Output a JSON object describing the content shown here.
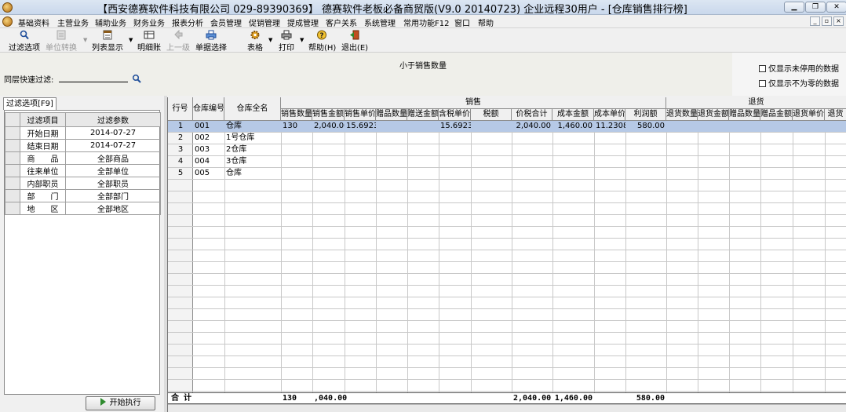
{
  "window": {
    "title": "【西安德赛软件科技有限公司 029-89390369】 德赛软件老板必备商贸版(V9.0 20140723) 企业远程30用户 - [仓库销售排行榜]",
    "min_label": "▁",
    "max_label": "❐",
    "close_label": "✕"
  },
  "menu": {
    "items": [
      "基础资料",
      "主营业务",
      "辅助业务",
      "财务业务",
      "报表分析",
      "会员管理",
      "促销管理",
      "提成管理",
      "客户关系",
      "系统管理",
      "常用功能F12",
      "窗口",
      "帮助"
    ],
    "mdi_min": "_",
    "mdi_restore": "▫",
    "mdi_close": "×"
  },
  "toolbar": {
    "filter_options": "过滤选项",
    "unit_convert": "单位转换",
    "list_display": "列表显示",
    "detail_account": "明细账",
    "prev_level": "上一级",
    "document_select": "单据选择",
    "table": "表格",
    "print": "打印",
    "help": "帮助(H)",
    "exit": "退出(E)"
  },
  "subheader": {
    "title": "小于销售数量",
    "quick_filter_label": "同层快速过滤:",
    "show_disabled_only": "仅显示未停用的数据",
    "show_nonzero_only": "仅显示不为零的数据"
  },
  "filter_panel": {
    "tab_label": "过滤选项[F9]",
    "col_item": "过滤项目",
    "col_param": "过滤参数",
    "rows": [
      {
        "item": "开始日期",
        "param": "2014-07-27"
      },
      {
        "item": "结束日期",
        "param": "2014-07-27"
      },
      {
        "item": "商　　品",
        "param": "全部商品"
      },
      {
        "item": "往来单位",
        "param": "全部单位"
      },
      {
        "item": "内部职员",
        "param": "全部职员"
      },
      {
        "item": "部　　门",
        "param": "全部部门"
      },
      {
        "item": "地　　区",
        "param": "全部地区"
      }
    ],
    "run_button": "开始执行"
  },
  "grid": {
    "col_rownum": "行号",
    "col_code": "仓库编号",
    "col_name": "仓库全名",
    "group_sales": "销售",
    "group_returns": "退货",
    "sales_cols": [
      "销售数量",
      "销售金额",
      "销售单价",
      "赠品数量",
      "赠送金额",
      "含税单价",
      "税额",
      "价税合计",
      "成本金额",
      "成本单价",
      "利润额"
    ],
    "return_cols": [
      "退货数量",
      "退货金额",
      "赠品数量",
      "赠品金额",
      "退货单价",
      "退货"
    ],
    "rows": [
      {
        "n": "1",
        "code": "001",
        "name": "仓库",
        "qty": "130",
        "amount": "2,040.00",
        "price": "15.6923",
        "tax_price": "15.6923",
        "total": "2,040.00",
        "cost": "1,460.00",
        "cost_price": "11.2308",
        "profit": "580.00"
      },
      {
        "n": "2",
        "code": "002",
        "name": "1号仓库",
        "qty": "",
        "amount": "",
        "price": "",
        "tax_price": "",
        "total": "",
        "cost": "",
        "cost_price": "",
        "profit": ""
      },
      {
        "n": "3",
        "code": "003",
        "name": "2仓库",
        "qty": "",
        "amount": "",
        "price": "",
        "tax_price": "",
        "total": "",
        "cost": "",
        "cost_price": "",
        "profit": ""
      },
      {
        "n": "4",
        "code": "004",
        "name": "3仓库",
        "qty": "",
        "amount": "",
        "price": "",
        "tax_price": "",
        "total": "",
        "cost": "",
        "cost_price": "",
        "profit": ""
      },
      {
        "n": "5",
        "code": "005",
        "name": "仓库",
        "qty": "",
        "amount": "",
        "price": "",
        "tax_price": "",
        "total": "",
        "cost": "",
        "cost_price": "",
        "profit": ""
      }
    ],
    "totals": {
      "label": "合 计",
      "qty": "130",
      "amount": ",040.00",
      "total": "2,040.00",
      "cost": "1,460.00",
      "profit": "580.00"
    }
  },
  "colors": {
    "selected_row": "#b6c9e6",
    "header_bg": "#f0f0f0",
    "run_icon": "#2e8b2e"
  }
}
